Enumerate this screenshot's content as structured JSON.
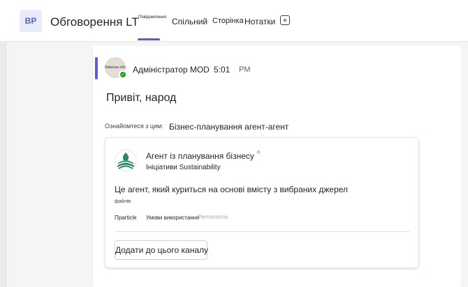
{
  "header": {
    "team_initials": "BP",
    "channel_name": "Обговорення LT",
    "tabs": [
      {
        "label": "Повідомлення"
      },
      {
        "label": "Спільний"
      },
      {
        "label": "Сторінка"
      },
      {
        "label": "Нотатки"
      }
    ],
    "add_tab_symbol": "+"
  },
  "post": {
    "avatar_text": "Київська обл",
    "author": "Адміністратор MOD",
    "time": "5:01",
    "ampm": "PM",
    "greeting": "Привіт, народ",
    "check_out_label": "Ознайомтеся з цим:",
    "agent_link": "Бізнес-планування агент-агент"
  },
  "card": {
    "title": "Агент із планування бізнесу",
    "subtitle": "Ініціативи Sustainability",
    "description": "Це агент, який куриться на основі вмісту з вибраних джерел",
    "description_cont": "файлів.",
    "links": {
      "privacy": "Пparticle",
      "terms": "Умови використання",
      "permissions": "Permissions"
    },
    "add_button": "Додати до цього каналу"
  },
  "colors": {
    "accent": "#5b5fc7",
    "presence": "#13a10e"
  }
}
